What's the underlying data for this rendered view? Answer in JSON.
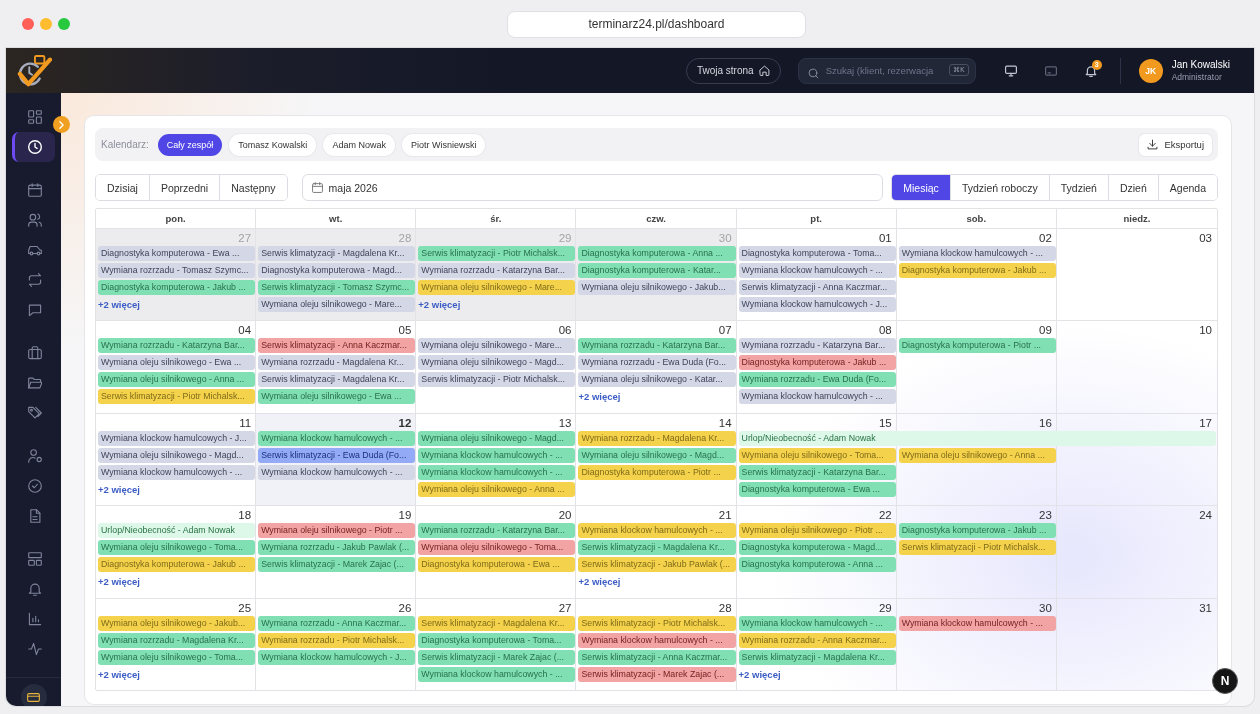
{
  "browser": {
    "url": "terminarz24.pl/dashboard"
  },
  "topbar": {
    "home_button": "Twoja strona",
    "search": {
      "placeholder": "Szukaj (klient, rezerwacja",
      "shortcut": "⌘K"
    },
    "notifications_badge": "3",
    "user": {
      "initials": "JK",
      "name": "Jan Kowalski",
      "role": "Administrator"
    }
  },
  "sidebar": {
    "groups": [
      {
        "items": [
          {
            "selected": false
          },
          {
            "selected": true
          }
        ]
      },
      {
        "items": [
          {
            "selected": false
          },
          {
            "selected": false
          },
          {
            "selected": false
          },
          {
            "selected": false
          },
          {
            "selected": false
          }
        ]
      },
      {
        "items": [
          {
            "selected": false
          },
          {
            "selected": false
          },
          {
            "selected": false
          }
        ]
      },
      {
        "items": [
          {
            "selected": false
          },
          {
            "selected": false
          },
          {
            "selected": false
          }
        ]
      },
      {
        "items": [
          {
            "selected": false
          },
          {
            "selected": false
          },
          {
            "selected": false
          },
          {
            "selected": false
          }
        ]
      }
    ]
  },
  "calendar_filter": {
    "label": "Kalendarz:",
    "options": [
      {
        "label": "Cały zespół",
        "selected": true
      },
      {
        "label": "Tomasz Kowalski",
        "selected": false
      },
      {
        "label": "Adam Nowak",
        "selected": false
      },
      {
        "label": "Piotr Wisniewski",
        "selected": false
      }
    ],
    "export_button": "Eksportuj"
  },
  "toolbar": {
    "navigation": [
      "Dzisiaj",
      "Poprzedni",
      "Następny"
    ],
    "period": "maja 2026",
    "views": [
      {
        "label": "Miesiąc",
        "selected": true
      },
      {
        "label": "Tydzień roboczy",
        "selected": false
      },
      {
        "label": "Tydzień",
        "selected": false
      },
      {
        "label": "Dzień",
        "selected": false
      },
      {
        "label": "Agenda",
        "selected": false
      }
    ]
  },
  "month": {
    "weekdays": [
      "pon.",
      "wt.",
      "śr.",
      "czw.",
      "pt.",
      "sob.",
      "niedz."
    ],
    "weeks": [
      {
        "days": [
          {
            "date": "27",
            "outside_month": true,
            "today": false,
            "events": [
              {
                "kind": "appointment",
                "title": "Diagnostyka komputerowa - Ewa ...",
                "color": "#d4d7e5"
              },
              {
                "kind": "appointment",
                "title": "Wymiana rozrzadu - Tomasz Szymc...",
                "color": "#d4d7e5"
              },
              {
                "kind": "appointment",
                "title": "Diagnostyka komputerowa - Jakub ...",
                "color": "#80e0b3"
              }
            ],
            "more": "+2 więcej"
          },
          {
            "date": "28",
            "outside_month": true,
            "today": false,
            "events": [
              {
                "kind": "appointment",
                "title": "Serwis klimatyzacji - Magdalena Kr...",
                "color": "#d4d7e5"
              },
              {
                "kind": "appointment",
                "title": "Diagnostyka komputerowa - Magd...",
                "color": "#d4d7e5"
              },
              {
                "kind": "appointment",
                "title": "Serwis klimatyzacji - Tomasz Szymc...",
                "color": "#80e0b3"
              },
              {
                "kind": "appointment",
                "title": "Wymiana oleju silnikowego - Mare...",
                "color": "#d4d7e5"
              }
            ]
          },
          {
            "date": "29",
            "outside_month": true,
            "today": false,
            "events": [
              {
                "kind": "appointment",
                "title": "Serwis klimatyzacji - Piotr Michalsk...",
                "color": "#80e0b3"
              },
              {
                "kind": "appointment",
                "title": "Wymiana rozrzadu - Katarzyna Bar...",
                "color": "#d4d7e5"
              },
              {
                "kind": "appointment",
                "title": "Wymiana oleju silnikowego - Mare...",
                "color": "#f4d24b"
              }
            ],
            "more": "+2 więcej"
          },
          {
            "date": "30",
            "outside_month": true,
            "today": false,
            "events": [
              {
                "kind": "appointment",
                "title": "Diagnostyka komputerowa - Anna ...",
                "color": "#80e0b3"
              },
              {
                "kind": "appointment",
                "title": "Diagnostyka komputerowa - Katar...",
                "color": "#80e0b3"
              },
              {
                "kind": "appointment",
                "title": "Wymiana oleju silnikowego - Jakub...",
                "color": "#d4d7e5"
              }
            ]
          },
          {
            "date": "01",
            "outside_month": false,
            "today": false,
            "events": [
              {
                "kind": "appointment",
                "title": "Diagnostyka komputerowa - Toma...",
                "color": "#d4d7e5"
              },
              {
                "kind": "appointment",
                "title": "Wymiana klockow hamulcowych - ...",
                "color": "#d4d7e5"
              },
              {
                "kind": "appointment",
                "title": "Serwis klimatyzacji - Anna Kaczmar...",
                "color": "#d4d7e5"
              },
              {
                "kind": "appointment",
                "title": "Wymiana klockow hamulcowych - J...",
                "color": "#d4d7e5"
              }
            ]
          },
          {
            "date": "02",
            "outside_month": false,
            "today": false,
            "events": [
              {
                "kind": "appointment",
                "title": "Wymiana klockow hamulcowych - ...",
                "color": "#d4d7e5"
              },
              {
                "kind": "appointment",
                "title": "Diagnostyka komputerowa - Jakub ...",
                "color": "#f4d24b"
              }
            ]
          },
          {
            "date": "03",
            "outside_month": false,
            "today": false
          }
        ]
      },
      {
        "days": [
          {
            "date": "04",
            "outside_month": false,
            "today": false,
            "events": [
              {
                "kind": "appointment",
                "title": "Wymiana rozrzadu - Katarzyna Bar...",
                "color": "#80e0b3"
              },
              {
                "kind": "appointment",
                "title": "Wymiana oleju silnikowego - Ewa ...",
                "color": "#d4d7e5"
              },
              {
                "kind": "appointment",
                "title": "Wymiana oleju silnikowego - Anna ...",
                "color": "#80e0b3"
              },
              {
                "kind": "appointment",
                "title": "Serwis klimatyzacji - Piotr Michalsk...",
                "color": "#f4d24b"
              }
            ]
          },
          {
            "date": "05",
            "outside_month": false,
            "today": false,
            "events": [
              {
                "kind": "appointment",
                "title": "Serwis klimatyzacji - Anna Kaczmar...",
                "color": "#f2a3a3"
              },
              {
                "kind": "appointment",
                "title": "Wymiana rozrzadu - Magdalena Kr...",
                "color": "#d4d7e5"
              },
              {
                "kind": "appointment",
                "title": "Serwis klimatyzacji - Magdalena Kr...",
                "color": "#d4d7e5"
              },
              {
                "kind": "appointment",
                "title": "Wymiana oleju silnikowego - Ewa ...",
                "color": "#80e0b3"
              }
            ]
          },
          {
            "date": "06",
            "outside_month": false,
            "today": false,
            "events": [
              {
                "kind": "appointment",
                "title": "Wymiana oleju silnikowego - Mare...",
                "color": "#d4d7e5"
              },
              {
                "kind": "appointment",
                "title": "Wymiana oleju silnikowego - Magd...",
                "color": "#d4d7e5"
              },
              {
                "kind": "appointment",
                "title": "Serwis klimatyzacji - Piotr Michalsk...",
                "color": "#d4d7e5"
              }
            ]
          },
          {
            "date": "07",
            "outside_month": false,
            "today": false,
            "events": [
              {
                "kind": "appointment",
                "title": "Wymiana rozrzadu - Katarzyna Bar...",
                "color": "#80e0b3"
              },
              {
                "kind": "appointment",
                "title": "Wymiana rozrzadu - Ewa Duda (Fo...",
                "color": "#d4d7e5"
              },
              {
                "kind": "appointment",
                "title": "Wymiana oleju silnikowego - Katar...",
                "color": "#d4d7e5"
              }
            ],
            "more": "+2 więcej"
          },
          {
            "date": "08",
            "outside_month": false,
            "today": false,
            "events": [
              {
                "kind": "appointment",
                "title": "Wymiana rozrzadu - Katarzyna Bar...",
                "color": "#d4d7e5"
              },
              {
                "kind": "appointment",
                "title": "Diagnostyka komputerowa - Jakub ...",
                "color": "#f2a3a3"
              },
              {
                "kind": "appointment",
                "title": "Wymiana rozrzadu - Ewa Duda (Fo...",
                "color": "#80e0b3"
              },
              {
                "kind": "appointment",
                "title": "Wymiana klockow hamulcowych - ...",
                "color": "#d4d7e5"
              }
            ]
          },
          {
            "date": "09",
            "outside_month": false,
            "today": false,
            "events": [
              {
                "kind": "appointment",
                "title": "Diagnostyka komputerowa - Piotr ...",
                "color": "#80e0b3"
              }
            ]
          },
          {
            "date": "10",
            "outside_month": false,
            "today": false
          }
        ]
      },
      {
        "days": [
          {
            "date": "11",
            "outside_month": false,
            "today": false,
            "events": [
              {
                "kind": "appointment",
                "title": "Wymiana klockow hamulcowych - J...",
                "color": "#d4d7e5"
              },
              {
                "kind": "appointment",
                "title": "Wymiana oleju silnikowego - Magd...",
                "color": "#d4d7e5"
              },
              {
                "kind": "appointment",
                "title": "Wymiana klockow hamulcowych - ...",
                "color": "#d4d7e5"
              }
            ],
            "more": "+2 więcej"
          },
          {
            "date": "12",
            "outside_month": false,
            "today": true,
            "events": [
              {
                "kind": "appointment",
                "title": "Wymiana klockow hamulcowych - ...",
                "color": "#80e0b3"
              },
              {
                "kind": "appointment",
                "title": "Serwis klimatyzacji - Ewa Duda (Fo...",
                "color": "#93aaf7"
              },
              {
                "kind": "appointment",
                "title": "Wymiana klockow hamulcowych - ...",
                "color": "#d4d7e5"
              }
            ]
          },
          {
            "date": "13",
            "outside_month": false,
            "today": false,
            "events": [
              {
                "kind": "appointment",
                "title": "Wymiana oleju silnikowego - Magd...",
                "color": "#80e0b3"
              },
              {
                "kind": "appointment",
                "title": "Wymiana klockow hamulcowych - ...",
                "color": "#80e0b3"
              },
              {
                "kind": "appointment",
                "title": "Wymiana klockow hamulcowych - ...",
                "color": "#80e0b3"
              },
              {
                "kind": "appointment",
                "title": "Wymiana oleju silnikowego - Anna ...",
                "color": "#f4d24b"
              }
            ]
          },
          {
            "date": "14",
            "outside_month": false,
            "today": false,
            "events": [
              {
                "kind": "appointment",
                "title": "Wymiana rozrzadu - Magdalena Kr...",
                "color": "#f4d24b"
              },
              {
                "kind": "appointment",
                "title": "Wymiana oleju silnikowego - Magd...",
                "color": "#80e0b3"
              },
              {
                "kind": "appointment",
                "title": "Diagnostyka komputerowa - Piotr ...",
                "color": "#f4d24b"
              }
            ]
          },
          {
            "date": "15",
            "outside_month": false,
            "today": false,
            "events": [
              {
                "kind": "range",
                "title": "Urlop/Nieobecność - Adam Nowak",
                "color": "#ddf8e8"
              },
              {
                "kind": "appointment",
                "title": "Wymiana oleju silnikowego - Toma...",
                "color": "#f4d24b"
              },
              {
                "kind": "appointment",
                "title": "Serwis klimatyzacji - Katarzyna Bar...",
                "color": "#80e0b3"
              },
              {
                "kind": "appointment",
                "title": "Diagnostyka komputerowa - Ewa ...",
                "color": "#80e0b3"
              }
            ]
          },
          {
            "date": "16",
            "outside_month": false,
            "today": false,
            "events": [
              {
                "kind": "continuation"
              },
              {
                "kind": "appointment",
                "title": "Wymiana oleju silnikowego - Anna ...",
                "color": "#f4d24b"
              }
            ]
          },
          {
            "date": "17",
            "outside_month": false,
            "today": false,
            "events": [
              {
                "kind": "continuation"
              }
            ]
          }
        ]
      },
      {
        "days": [
          {
            "date": "18",
            "outside_month": false,
            "today": false,
            "events": [
              {
                "kind": "appointment",
                "title": "Urlop/Nieobecność - Adam Nowak",
                "color": "#ddf8e8"
              },
              {
                "kind": "appointment",
                "title": "Wymiana oleju silnikowego - Toma...",
                "color": "#80e0b3"
              },
              {
                "kind": "appointment",
                "title": "Diagnostyka komputerowa - Jakub ...",
                "color": "#f4d24b"
              }
            ],
            "more": "+2 więcej"
          },
          {
            "date": "19",
            "outside_month": false,
            "today": false,
            "events": [
              {
                "kind": "appointment",
                "title": "Wymiana oleju silnikowego - Piotr ...",
                "color": "#f2a3a3"
              },
              {
                "kind": "appointment",
                "title": "Wymiana rozrzadu - Jakub Pawlak (...",
                "color": "#80e0b3"
              },
              {
                "kind": "appointment",
                "title": "Serwis klimatyzacji - Marek Zajac (...",
                "color": "#80e0b3"
              }
            ]
          },
          {
            "date": "20",
            "outside_month": false,
            "today": false,
            "events": [
              {
                "kind": "appointment",
                "title": "Wymiana rozrzadu - Katarzyna Bar...",
                "color": "#80e0b3"
              },
              {
                "kind": "appointment",
                "title": "Wymiana oleju silnikowego - Toma...",
                "color": "#f2a3a3"
              },
              {
                "kind": "appointment",
                "title": "Diagnostyka komputerowa - Ewa ...",
                "color": "#f4d24b"
              }
            ]
          },
          {
            "date": "21",
            "outside_month": false,
            "today": false,
            "events": [
              {
                "kind": "appointment",
                "title": "Wymiana klockow hamulcowych - ...",
                "color": "#f4d24b"
              },
              {
                "kind": "appointment",
                "title": "Serwis klimatyzacji - Magdalena Kr...",
                "color": "#80e0b3"
              },
              {
                "kind": "appointment",
                "title": "Serwis klimatyzacji - Jakub Pawlak (...",
                "color": "#f4d24b"
              }
            ],
            "more": "+2 więcej"
          },
          {
            "date": "22",
            "outside_month": false,
            "today": false,
            "events": [
              {
                "kind": "appointment",
                "title": "Wymiana oleju silnikowego - Piotr ...",
                "color": "#f4d24b"
              },
              {
                "kind": "appointment",
                "title": "Diagnostyka komputerowa - Magd...",
                "color": "#80e0b3"
              },
              {
                "kind": "appointment",
                "title": "Diagnostyka komputerowa - Anna ...",
                "color": "#80e0b3"
              }
            ]
          },
          {
            "date": "23",
            "outside_month": false,
            "today": false,
            "events": [
              {
                "kind": "appointment",
                "title": "Diagnostyka komputerowa - Jakub ...",
                "color": "#80e0b3"
              },
              {
                "kind": "appointment",
                "title": "Serwis klimatyzacji - Piotr Michalsk...",
                "color": "#f4d24b"
              }
            ]
          },
          {
            "date": "24",
            "outside_month": false,
            "today": false
          }
        ]
      },
      {
        "days": [
          {
            "date": "25",
            "outside_month": false,
            "today": false,
            "events": [
              {
                "kind": "appointment",
                "title": "Wymiana oleju silnikowego - Jakub...",
                "color": "#f4d24b"
              },
              {
                "kind": "appointment",
                "title": "Wymiana rozrzadu - Magdalena Kr...",
                "color": "#80e0b3"
              },
              {
                "kind": "appointment",
                "title": "Wymiana oleju silnikowego - Toma...",
                "color": "#80e0b3"
              }
            ],
            "more": "+2 więcej"
          },
          {
            "date": "26",
            "outside_month": false,
            "today": false,
            "events": [
              {
                "kind": "appointment",
                "title": "Wymiana rozrzadu - Anna Kaczmar...",
                "color": "#80e0b3"
              },
              {
                "kind": "appointment",
                "title": "Wymiana rozrzadu - Piotr Michalsk...",
                "color": "#f4d24b"
              },
              {
                "kind": "appointment",
                "title": "Wymiana klockow hamulcowych - J...",
                "color": "#80e0b3"
              }
            ]
          },
          {
            "date": "27",
            "outside_month": false,
            "today": false,
            "events": [
              {
                "kind": "appointment",
                "title": "Serwis klimatyzacji - Magdalena Kr...",
                "color": "#f4d24b"
              },
              {
                "kind": "appointment",
                "title": "Diagnostyka komputerowa - Toma...",
                "color": "#80e0b3"
              },
              {
                "kind": "appointment",
                "title": "Serwis klimatyzacji - Marek Zajac (...",
                "color": "#80e0b3"
              },
              {
                "kind": "appointment",
                "title": "Wymiana klockow hamulcowych - ...",
                "color": "#80e0b3"
              }
            ]
          },
          {
            "date": "28",
            "outside_month": false,
            "today": false,
            "events": [
              {
                "kind": "appointment",
                "title": "Serwis klimatyzacji - Piotr Michalsk...",
                "color": "#f4d24b"
              },
              {
                "kind": "appointment",
                "title": "Wymiana klockow hamulcowych - ...",
                "color": "#f2a3a3"
              },
              {
                "kind": "appointment",
                "title": "Serwis klimatyzacji - Anna Kaczmar...",
                "color": "#80e0b3"
              },
              {
                "kind": "appointment",
                "title": "Serwis klimatyzacji - Marek Zajac (...",
                "color": "#f2a3a3"
              }
            ]
          },
          {
            "date": "29",
            "outside_month": false,
            "today": false,
            "events": [
              {
                "kind": "appointment",
                "title": "Wymiana klockow hamulcowych - ...",
                "color": "#80e0b3"
              },
              {
                "kind": "appointment",
                "title": "Wymiana rozrzadu - Anna Kaczmar...",
                "color": "#f4d24b"
              },
              {
                "kind": "appointment",
                "title": "Serwis klimatyzacji - Magdalena Kr...",
                "color": "#80e0b3"
              }
            ],
            "more": "+2 więcej"
          },
          {
            "date": "30",
            "outside_month": false,
            "today": false,
            "events": [
              {
                "kind": "appointment",
                "title": "Wymiana klockow hamulcowych - ...",
                "color": "#f2a3a3"
              }
            ]
          },
          {
            "date": "31",
            "outside_month": false,
            "today": false
          }
        ]
      }
    ]
  },
  "dev_badge": {
    "label": "N"
  }
}
